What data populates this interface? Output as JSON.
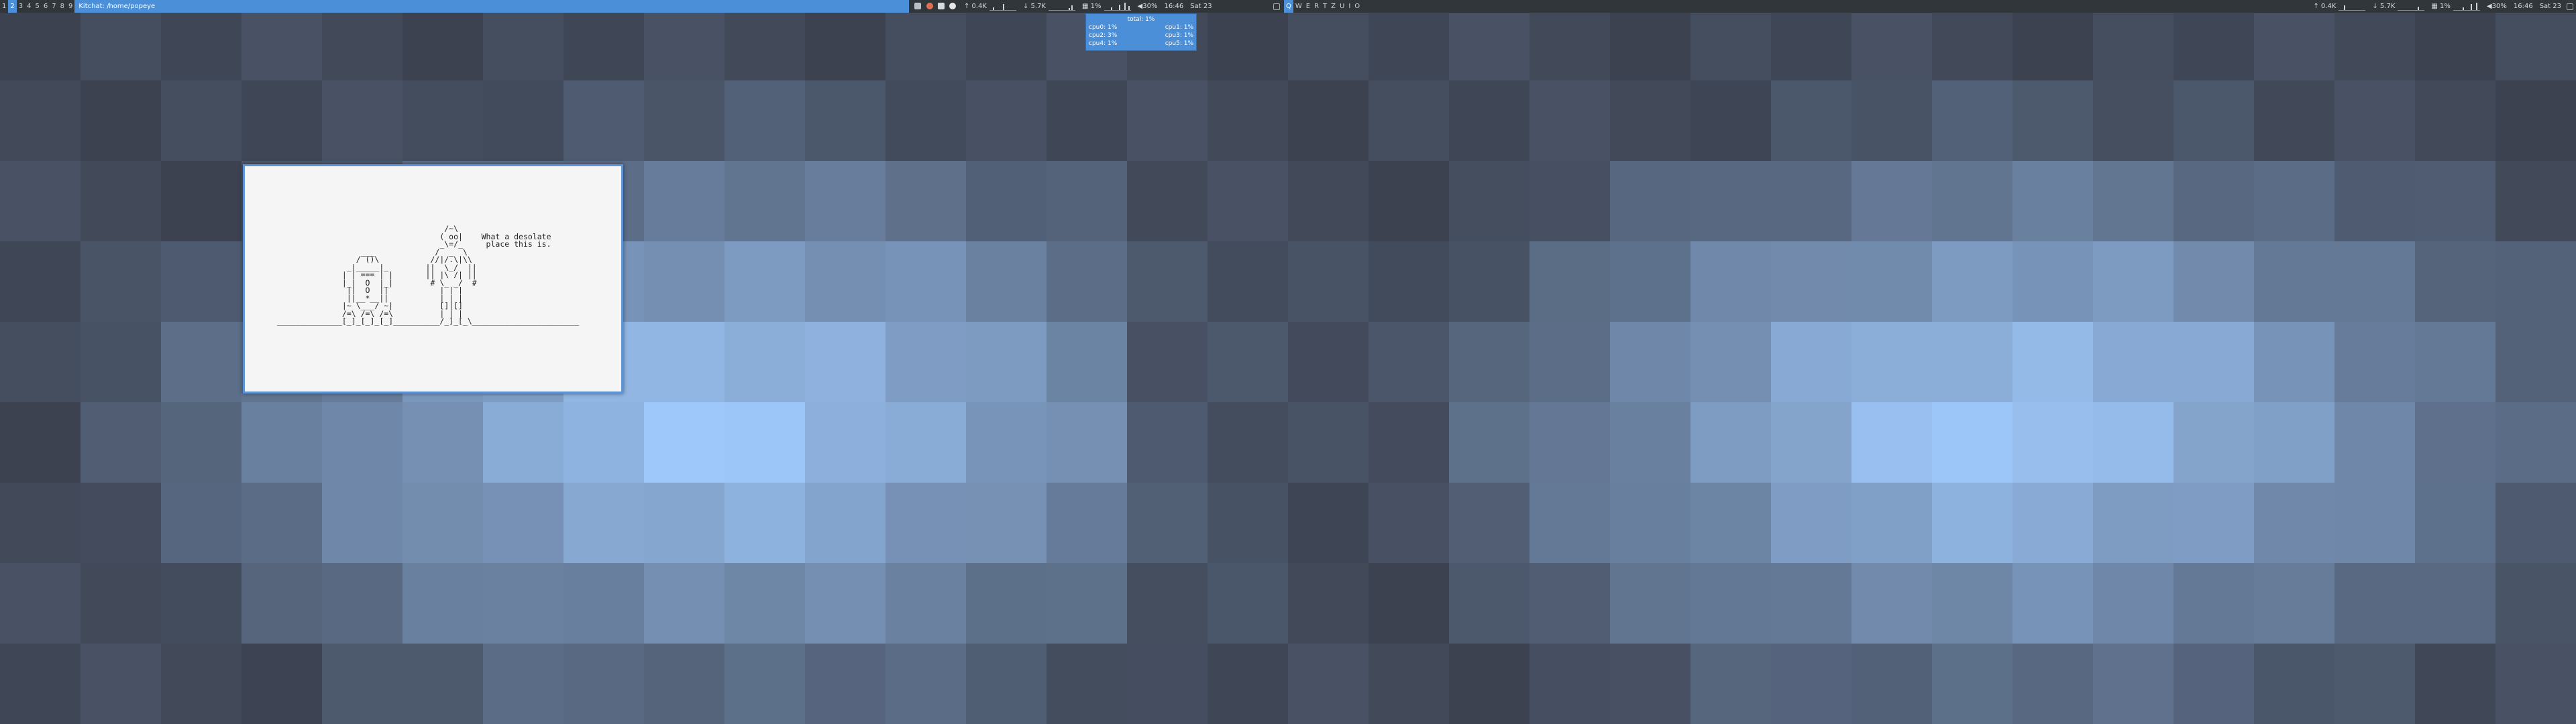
{
  "left_bar": {
    "workspaces": [
      {
        "label": "1",
        "state": "normal"
      },
      {
        "label": "2",
        "state": "active"
      },
      {
        "label": "3",
        "state": "normal"
      },
      {
        "label": "4",
        "state": "normal"
      },
      {
        "label": "5",
        "state": "normal"
      },
      {
        "label": "6",
        "state": "normal"
      },
      {
        "label": "7",
        "state": "normal"
      },
      {
        "label": "8",
        "state": "normal"
      },
      {
        "label": "9",
        "state": "normal"
      }
    ],
    "window_title": "Kitchat: /home/popeye",
    "net_up": "↑ 0.4K",
    "net_down": "↓ 5.7K",
    "cpu": "1%",
    "volume": "30%",
    "time": "16:46",
    "date": "Sat 23"
  },
  "right_bar": {
    "workspaces": [
      {
        "label": "Q",
        "state": "active"
      },
      {
        "label": "W",
        "state": "normal"
      },
      {
        "label": "E",
        "state": "normal"
      },
      {
        "label": "R",
        "state": "normal"
      },
      {
        "label": "T",
        "state": "normal"
      },
      {
        "label": "Z",
        "state": "normal"
      },
      {
        "label": "U",
        "state": "normal"
      },
      {
        "label": "I",
        "state": "normal"
      },
      {
        "label": "O",
        "state": "normal"
      }
    ],
    "net_up": "↑ 0.4K",
    "net_down": "↓ 5.7K",
    "cpu": "1%",
    "volume": "30%",
    "time": "16:46",
    "date": "Sat 23"
  },
  "cpu_popup": {
    "total": "total: 1%",
    "rows": [
      {
        "left": "cpu0:  1%",
        "right": "cpu1:  1%"
      },
      {
        "left": "cpu2:  3%",
        "right": "cpu3:  1%"
      },
      {
        "left": "cpu4:  1%",
        "right": "cpu5:  1%"
      }
    ]
  },
  "terminal": {
    "ascii_art": "                                    /~\\\n                                   ( oo|    What a desolate\n                                   _\\=/_     place this is.\n                  ___             /  _  \\\n                 / ()\\           //|/.\\|\\\\\n               _|_____|_        ||  \\_/  ||\n              | | === | |       || |\\ /| ||\n              |_|  O  |_|        # \\_ _/  #\n               ||  O  ||           | | |\n               ||__*__||           | | |\n              |~ \\___/ ~|          []|[]\n              /=\\ /=\\ /=\\          | | |\n______________[_]_[_]_[_]__________/_]_[_\\_______________________"
  },
  "colors": {
    "bar_bg": "#31363b",
    "accent": "#4a8fd8",
    "terminal_bg": "#f5f5f5"
  }
}
